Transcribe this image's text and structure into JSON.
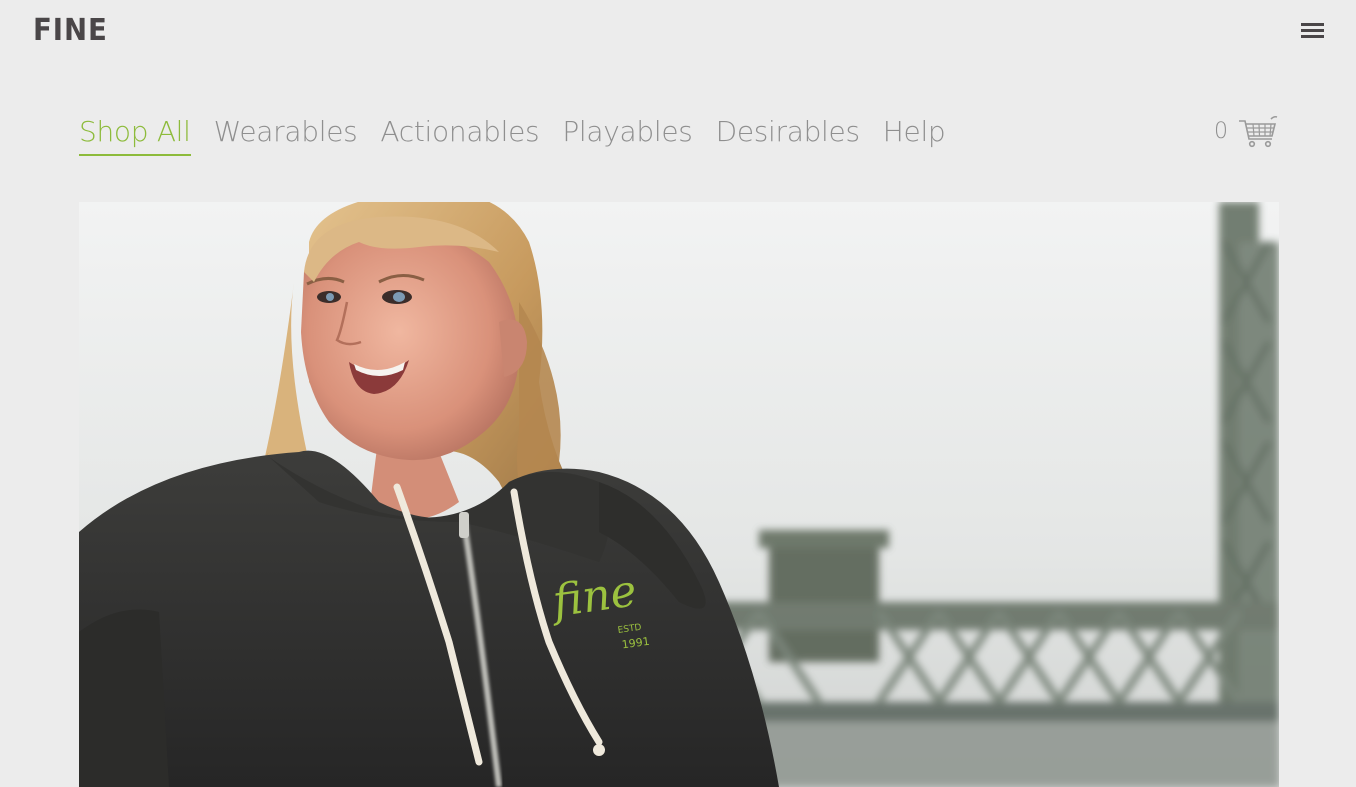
{
  "brand": {
    "name": "FINE"
  },
  "header": {
    "menu_icon": "hamburger-menu-icon"
  },
  "nav": {
    "items": [
      {
        "label": "Shop All",
        "active": true
      },
      {
        "label": "Wearables",
        "active": false
      },
      {
        "label": "Actionables",
        "active": false
      },
      {
        "label": "Playables",
        "active": false
      },
      {
        "label": "Desirables",
        "active": false
      },
      {
        "label": "Help",
        "active": false
      }
    ]
  },
  "cart": {
    "count": "0",
    "icon": "shopping-cart-icon"
  },
  "hero": {
    "subject": "smiling woman in charcoal zip hoodie in front of bridge",
    "hoodie_logo": "fine"
  },
  "colors": {
    "accent": "#8dbb3b",
    "nav_text": "#8f8f8f",
    "brand_text": "#4a4648",
    "background": "#ececec"
  }
}
